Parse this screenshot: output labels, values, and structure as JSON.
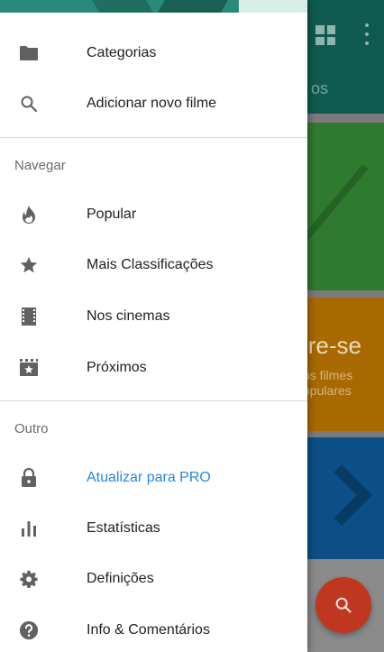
{
  "background": {
    "tab_partial": "os",
    "card_title_partial": "ire-se",
    "card_subtitle_partial": "os filmes\nopulares"
  },
  "drawer": {
    "top_items": [
      {
        "label": "Categorias",
        "icon": "folder-icon"
      },
      {
        "label": "Adicionar novo filme",
        "icon": "search-icon"
      }
    ],
    "navigate_header": "Navegar",
    "navigate_items": [
      {
        "label": "Popular",
        "icon": "fire-icon"
      },
      {
        "label": "Mais Classificações",
        "icon": "star-icon"
      },
      {
        "label": "Nos cinemas",
        "icon": "film-icon"
      },
      {
        "label": "Próximos",
        "icon": "clapperboard-icon"
      }
    ],
    "other_header": "Outro",
    "other_items": [
      {
        "label": "Atualizar para PRO",
        "icon": "lock-icon",
        "accent": "#1e88e5"
      },
      {
        "label": "Estatísticas",
        "icon": "bar-chart-icon"
      },
      {
        "label": "Definições",
        "icon": "gear-icon"
      },
      {
        "label": "Info & Comentários",
        "icon": "help-icon"
      }
    ]
  },
  "colors": {
    "accent": "#1e88e5",
    "icon": "#616161",
    "fab": "#bf3720"
  }
}
